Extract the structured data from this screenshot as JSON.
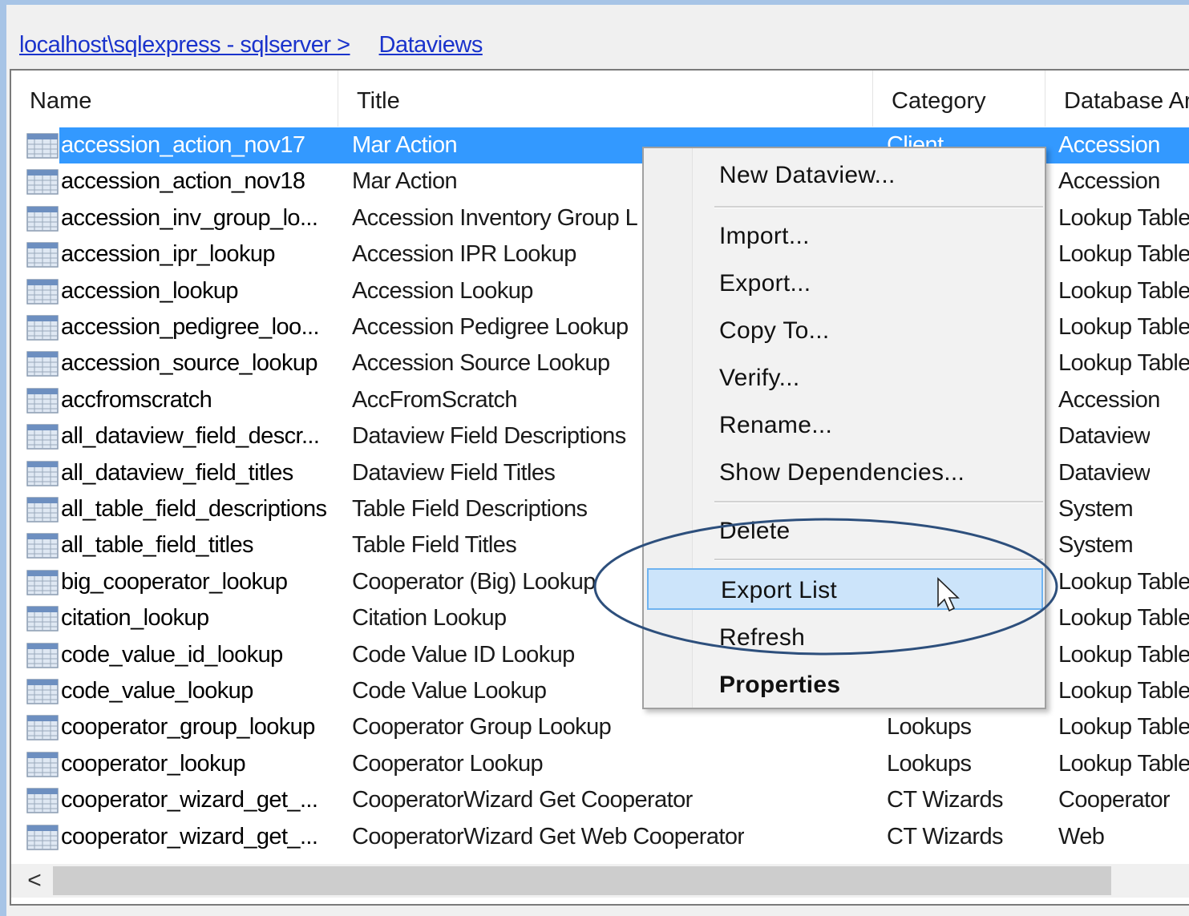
{
  "breadcrumb": {
    "server": "localhost\\sqlexpress - sqlserver >",
    "current": "Dataviews"
  },
  "columns": [
    "Name",
    "Title",
    "Category",
    "Database Are"
  ],
  "rows": [
    {
      "name": "accession_action_nov17",
      "title": "Mar Action",
      "category": "Client",
      "area": "Accession",
      "selected": true
    },
    {
      "name": "accession_action_nov18",
      "title": "Mar Action",
      "category": "",
      "area": "Accession"
    },
    {
      "name": "accession_inv_group_lo...",
      "title": "Accession Inventory Group L",
      "category": "",
      "area": "Lookup Table"
    },
    {
      "name": "accession_ipr_lookup",
      "title": "Accession IPR Lookup",
      "category": "",
      "area": "Lookup Table"
    },
    {
      "name": "accession_lookup",
      "title": "Accession Lookup",
      "category": "",
      "area": "Lookup Table"
    },
    {
      "name": "accession_pedigree_loo...",
      "title": "Accession Pedigree Lookup",
      "category": "",
      "area": "Lookup Table"
    },
    {
      "name": "accession_source_lookup",
      "title": "Accession Source Lookup",
      "category": "",
      "area": "Lookup Table"
    },
    {
      "name": "accfromscratch",
      "title": "AccFromScratch",
      "category": "",
      "area": "Accession"
    },
    {
      "name": "all_dataview_field_descr...",
      "title": "Dataview Field Descriptions",
      "category": "",
      "area": "Dataview"
    },
    {
      "name": "all_dataview_field_titles",
      "title": "Dataview Field Titles",
      "category": "",
      "area": "Dataview"
    },
    {
      "name": "all_table_field_descriptions",
      "title": "Table Field Descriptions",
      "category": "",
      "area": "System"
    },
    {
      "name": "all_table_field_titles",
      "title": "Table Field Titles",
      "category": "",
      "area": "System"
    },
    {
      "name": "big_cooperator_lookup",
      "title": "Cooperator (Big) Lookup",
      "category": "",
      "area": "Lookup Table"
    },
    {
      "name": "citation_lookup",
      "title": "Citation Lookup",
      "category": "",
      "area": "Lookup Table"
    },
    {
      "name": "code_value_id_lookup",
      "title": "Code Value ID Lookup",
      "category": "",
      "area": "Lookup Table"
    },
    {
      "name": "code_value_lookup",
      "title": "Code Value Lookup",
      "category": "",
      "area": "Lookup Table"
    },
    {
      "name": "cooperator_group_lookup",
      "title": "Cooperator Group Lookup",
      "category": "Lookups",
      "area": "Lookup Table"
    },
    {
      "name": "cooperator_lookup",
      "title": "Cooperator Lookup",
      "category": "Lookups",
      "area": "Lookup Table"
    },
    {
      "name": "cooperator_wizard_get_...",
      "title": "CooperatorWizard Get Cooperator",
      "category": "CT Wizards",
      "area": "Cooperator"
    },
    {
      "name": "cooperator_wizard_get_...",
      "title": "CooperatorWizard Get Web Cooperator",
      "category": "CT Wizards",
      "area": "Web"
    }
  ],
  "scrollbar": {
    "left_arrow": "<"
  },
  "context_menu": {
    "items": [
      {
        "label": "New Dataview..."
      },
      {
        "label": "Import..."
      },
      {
        "label": "Export..."
      },
      {
        "label": "Copy To..."
      },
      {
        "label": "Verify..."
      },
      {
        "label": "Rename..."
      },
      {
        "label": "Show Dependencies..."
      },
      {
        "label": "Delete"
      },
      {
        "label": "Export List",
        "highlighted": true
      },
      {
        "label": "Refresh"
      },
      {
        "label": "Properties",
        "bold": true
      }
    ]
  },
  "colors": {
    "selection": "#3399ff",
    "menu_highlight": "#cce4fa",
    "annotation_ellipse": "#2d4f7c",
    "link": "#1a33cc"
  }
}
